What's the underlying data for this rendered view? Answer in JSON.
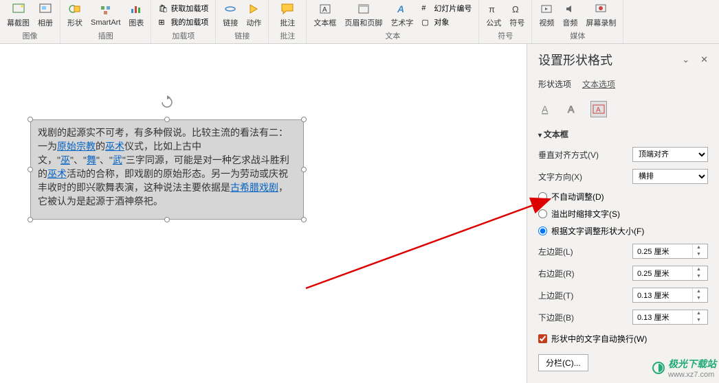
{
  "ribbon": {
    "groups": {
      "image": {
        "label": "图像",
        "screenshot": "幕截图",
        "album": "相册"
      },
      "illustration": {
        "label": "插图",
        "shape": "形状",
        "smartart": "SmartArt",
        "chart": "图表"
      },
      "addins": {
        "label": "加载项",
        "get": "获取加载项",
        "my": "我的加载项"
      },
      "links": {
        "label": "链接",
        "link": "链接",
        "action": "动作"
      },
      "comment": {
        "label": "批注",
        "item": "批注"
      },
      "text": {
        "label": "文本",
        "textbox": "文本框",
        "headerfooter": "页眉和页脚",
        "wordart": "艺术字",
        "slidenum": "幻灯片编号",
        "object": "对象"
      },
      "symbols": {
        "label": "符号",
        "equation": "公式",
        "symbol": "符号"
      },
      "media": {
        "label": "媒体",
        "video": "视频",
        "audio": "音频",
        "screenrec": "屏幕录制"
      }
    }
  },
  "textbox": {
    "content": {
      "p1a": "戏剧的起源实不可考，有多种假说。比较主流的看法有二：一为",
      "link1": "原始宗教",
      "p1b": "的",
      "link2": "巫术",
      "p1c": "仪式，比如上古中文，\"",
      "link3": "巫",
      "p1d": "\"、\"",
      "link4": "舞",
      "p1e": "\"、\"",
      "link5": "武",
      "p1f": "\"三字同源，可能是对一种乞求战斗胜利的",
      "link6": "巫术",
      "p1g": "活动的合称，即戏剧的原始形态。另一为劳动或庆祝丰收时的即兴歌舞表演，这种说法主要依据是",
      "link7": "古希腊戏剧",
      "p1h": "，它被认为是起源于酒神祭祀。"
    }
  },
  "pane": {
    "title": "设置形状格式",
    "tabs": {
      "shape": "形状选项",
      "text": "文本选项"
    },
    "section": "文本框",
    "valign": {
      "label": "垂直对齐方式(V)",
      "value": "顶端对齐"
    },
    "textdir": {
      "label": "文字方向(X)",
      "value": "横排"
    },
    "autosize": {
      "none": "不自动调整(D)",
      "shrink": "溢出时缩排文字(S)",
      "fit": "根据文字调整形状大小(F)"
    },
    "margins": {
      "left": {
        "label": "左边距(L)",
        "value": "0.25 厘米"
      },
      "right": {
        "label": "右边距(R)",
        "value": "0.25 厘米"
      },
      "top": {
        "label": "上边距(T)",
        "value": "0.13 厘米"
      },
      "bottom": {
        "label": "下边距(B)",
        "value": "0.13 厘米"
      }
    },
    "wrap": "形状中的文字自动换行(W)",
    "columns": "分栏(C)..."
  },
  "watermark": {
    "brand": "极光下载站",
    "url": "www.xz7.com"
  }
}
